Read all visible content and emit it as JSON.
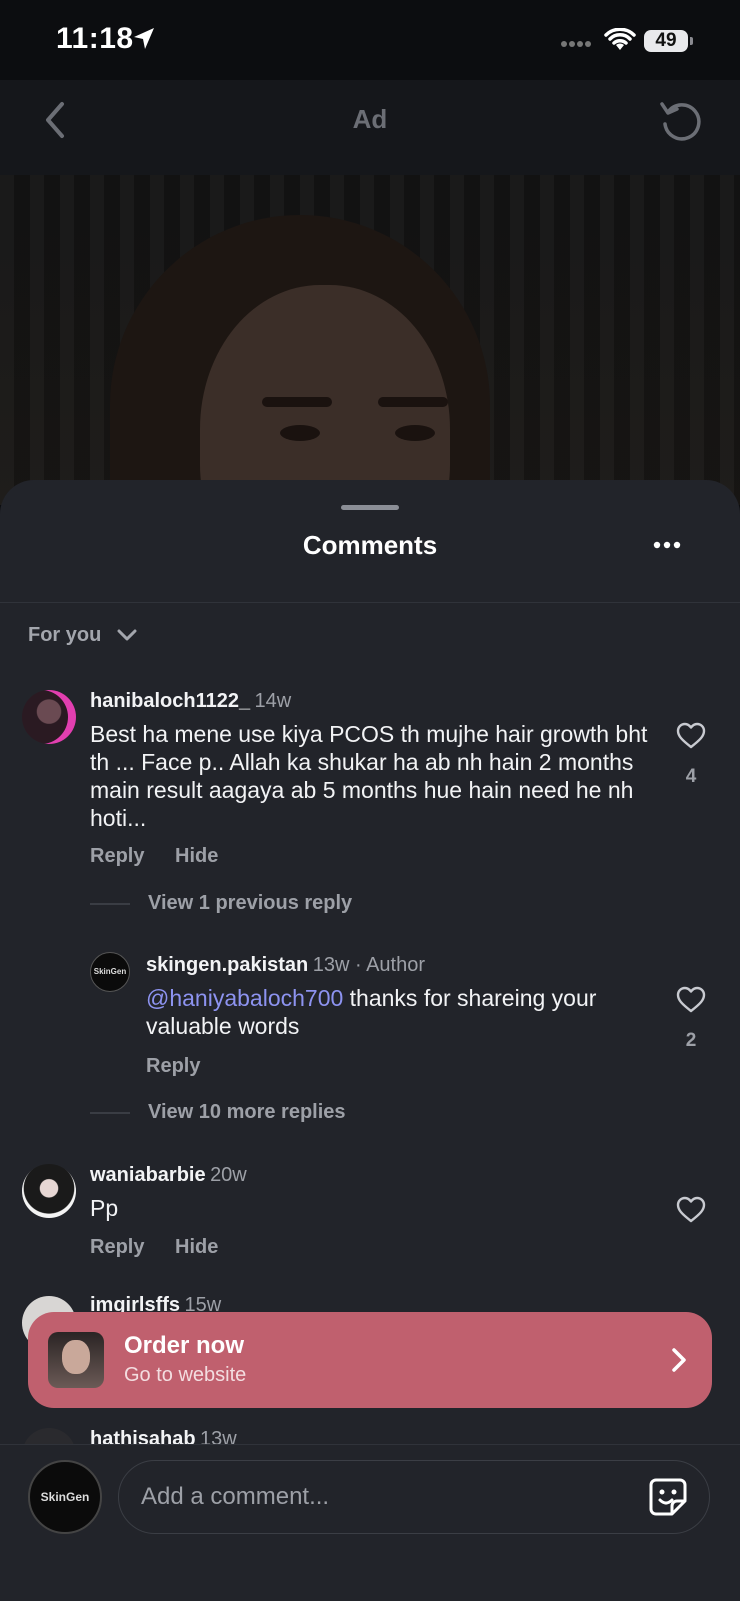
{
  "status_bar": {
    "time": "11:18",
    "battery": "49"
  },
  "nav": {
    "title": "Ad",
    "back_icon": "chevron-left-icon",
    "refresh_icon": "refresh-icon"
  },
  "sheet": {
    "title": "Comments",
    "filter": "For you"
  },
  "comments": [
    {
      "username": "hanibaloch1122_",
      "time": "14w",
      "text": "Best ha mene use kiya PCOS th mujhe hair growth bht th ... Face p.. Allah ka shukar ha ab nh hain 2 months main result aagaya ab 5 months hue hain need he nh hoti...",
      "likes": "4",
      "reply_label": "Reply",
      "hide_label": "Hide",
      "view_previous": "View 1 previous reply",
      "reply": {
        "username": "skingen.pakistan",
        "meta": "13w · Author",
        "mention": "@haniyabaloch700",
        "text": " thanks for shareing your valuable words",
        "likes": "2",
        "reply_label": "Reply",
        "avatar_text": "SkinGen"
      },
      "view_more": "View 10 more replies"
    },
    {
      "username": "waniabarbie",
      "time": "20w",
      "text": "Pp",
      "reply_label": "Reply",
      "hide_label": "Hide"
    },
    {
      "username": "imgirlsffs",
      "time": "15w"
    },
    {
      "username": "hathisahab",
      "time": "13w"
    }
  ],
  "cta": {
    "title": "Order now",
    "subtitle": "Go to website"
  },
  "composer": {
    "placeholder": "Add a comment...",
    "avatar_text": "SkinGen"
  },
  "colors": {
    "sheet": "#22242a",
    "cta": "#c0606e",
    "mention": "#8d93f0"
  }
}
